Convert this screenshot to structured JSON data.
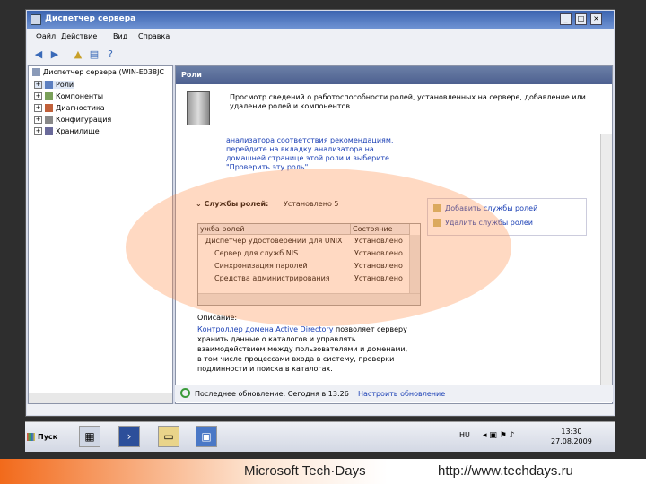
{
  "window": {
    "title": "Диспетчер сервера",
    "controls": {
      "minimize": "_",
      "maximize": "□",
      "close": "×"
    }
  },
  "menu": [
    "Файл",
    "Действие",
    "Вид",
    "Справка"
  ],
  "toolbar": {
    "icons": [
      "back-arrow-icon",
      "forward-arrow-icon",
      "up-folder-icon",
      "properties-icon",
      "help-icon"
    ]
  },
  "tree": {
    "root": "Диспетчер сервера (WIN-E038JC",
    "items": [
      "Роли",
      "Компоненты",
      "Диагностика",
      "Конфигурация",
      "Хранилище"
    ]
  },
  "pane": {
    "title": "Роли",
    "description": "Просмотр сведений о работоспособности ролей, установленных на сервере, добавление или удаление ролей и компонентов.",
    "analyzer_text": "анализатора соответствия рекомендациям, перейдите на вкладку анализатора на домашней странице этой роли и выберите \"Проверить эту роль\"."
  },
  "role_services": {
    "header": "Службы ролей:",
    "count": "Установлено 5",
    "columns": [
      "ужба ролей",
      "Состояние"
    ],
    "rows": [
      {
        "name": "Диспетчер удостоверений для UNIX",
        "status": "Установлено"
      },
      {
        "name": "Сервер для служб NIS",
        "status": "Установлено"
      },
      {
        "name": "Синхронизация паролей",
        "status": "Установлено"
      },
      {
        "name": "Средства администрирования",
        "status": "Установлено"
      }
    ],
    "tasks": [
      "Добавить службы ролей",
      "Удалить службы ролей"
    ]
  },
  "description": {
    "label": "Описание:",
    "link": "Контроллер домена Active Directory",
    "text": " позволяет серверу хранить данные о каталогов и управлять взаимодействием между пользователями и доменами, в том числе процессами входа в систему, проверки подлинности и поиска в каталогах."
  },
  "status": {
    "last_update": "Последнее обновление: Сегодня в 13:26",
    "configure_link": "Настроить обновление"
  },
  "taskbar": {
    "start": "Пуск",
    "language": "HU",
    "time": "13:30",
    "date": "27.08.2009"
  },
  "footer": {
    "left": "Microsoft Tech·Days",
    "right": "http://www.techdays.ru"
  },
  "colors": {
    "highlight": "#f8a46a",
    "link": "#1a3fb5",
    "pane_header": "#5a6c98"
  }
}
